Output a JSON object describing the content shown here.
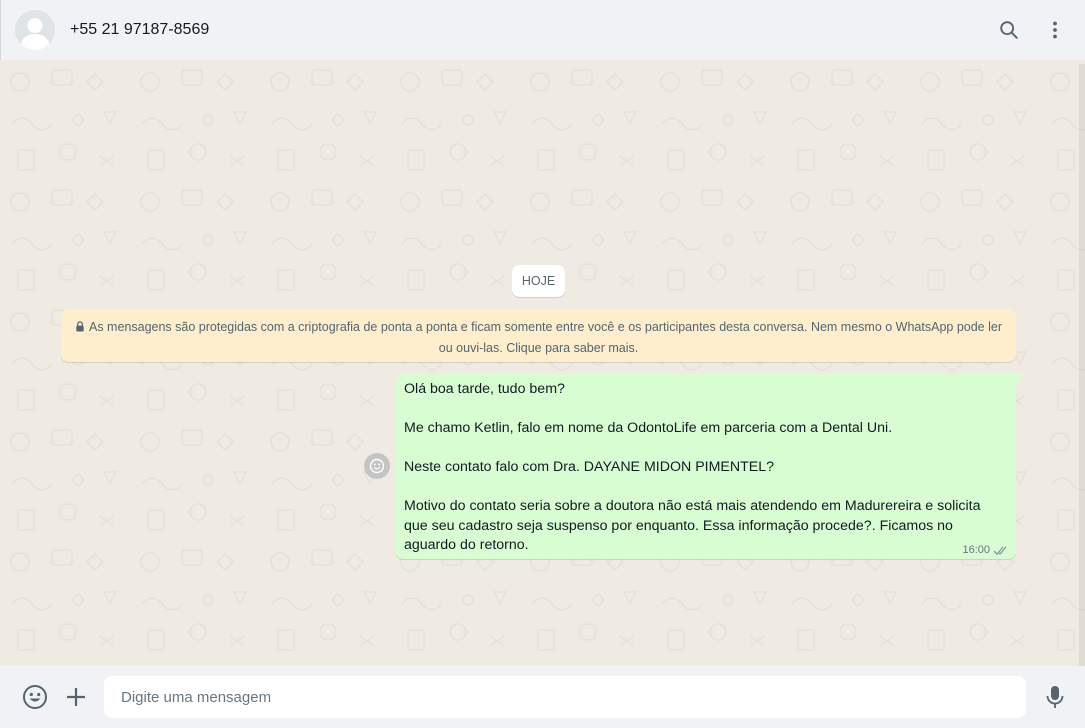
{
  "header": {
    "contact_name": "+55 21 97187-8569",
    "icons": [
      "default-avatar-icon",
      "search-icon",
      "menu-icon"
    ]
  },
  "chat": {
    "day_label": "HOJE",
    "encryption_notice_line1": "As mensagens são protegidas com a criptografia de ponta a ponta e ficam somente entre você e os participantes desta conversa. Nem mesmo o WhatsApp pode ler",
    "encryption_notice_line2": "ou ouvi-las. Clique para saber mais.",
    "messages": [
      {
        "direction": "outgoing",
        "text": "Olá boa tarde, tudo bem?\n\nMe chamo Ketlin, falo em nome da OdontoLife em parceria com a Dental Uni.\n\nNeste contato falo com Dra. DAYANE MIDON PIMENTEL?\n\nMotivo do contato seria sobre a doutora não está mais atendendo em Madurereira e solicita que seu cadastro seja suspenso por enquanto. Essa informação procede?. Ficamos no aguardo do retorno.",
        "time": "16:00",
        "status": "delivered"
      }
    ]
  },
  "composer": {
    "placeholder": "Digite uma mensagem",
    "value": ""
  },
  "colors": {
    "header_bg": "#f0f2f5",
    "chat_bg": "#efeae2",
    "outgoing_bubble": "#d9fdd3",
    "notice_bg": "#ffeecd",
    "icon": "#54656f"
  }
}
